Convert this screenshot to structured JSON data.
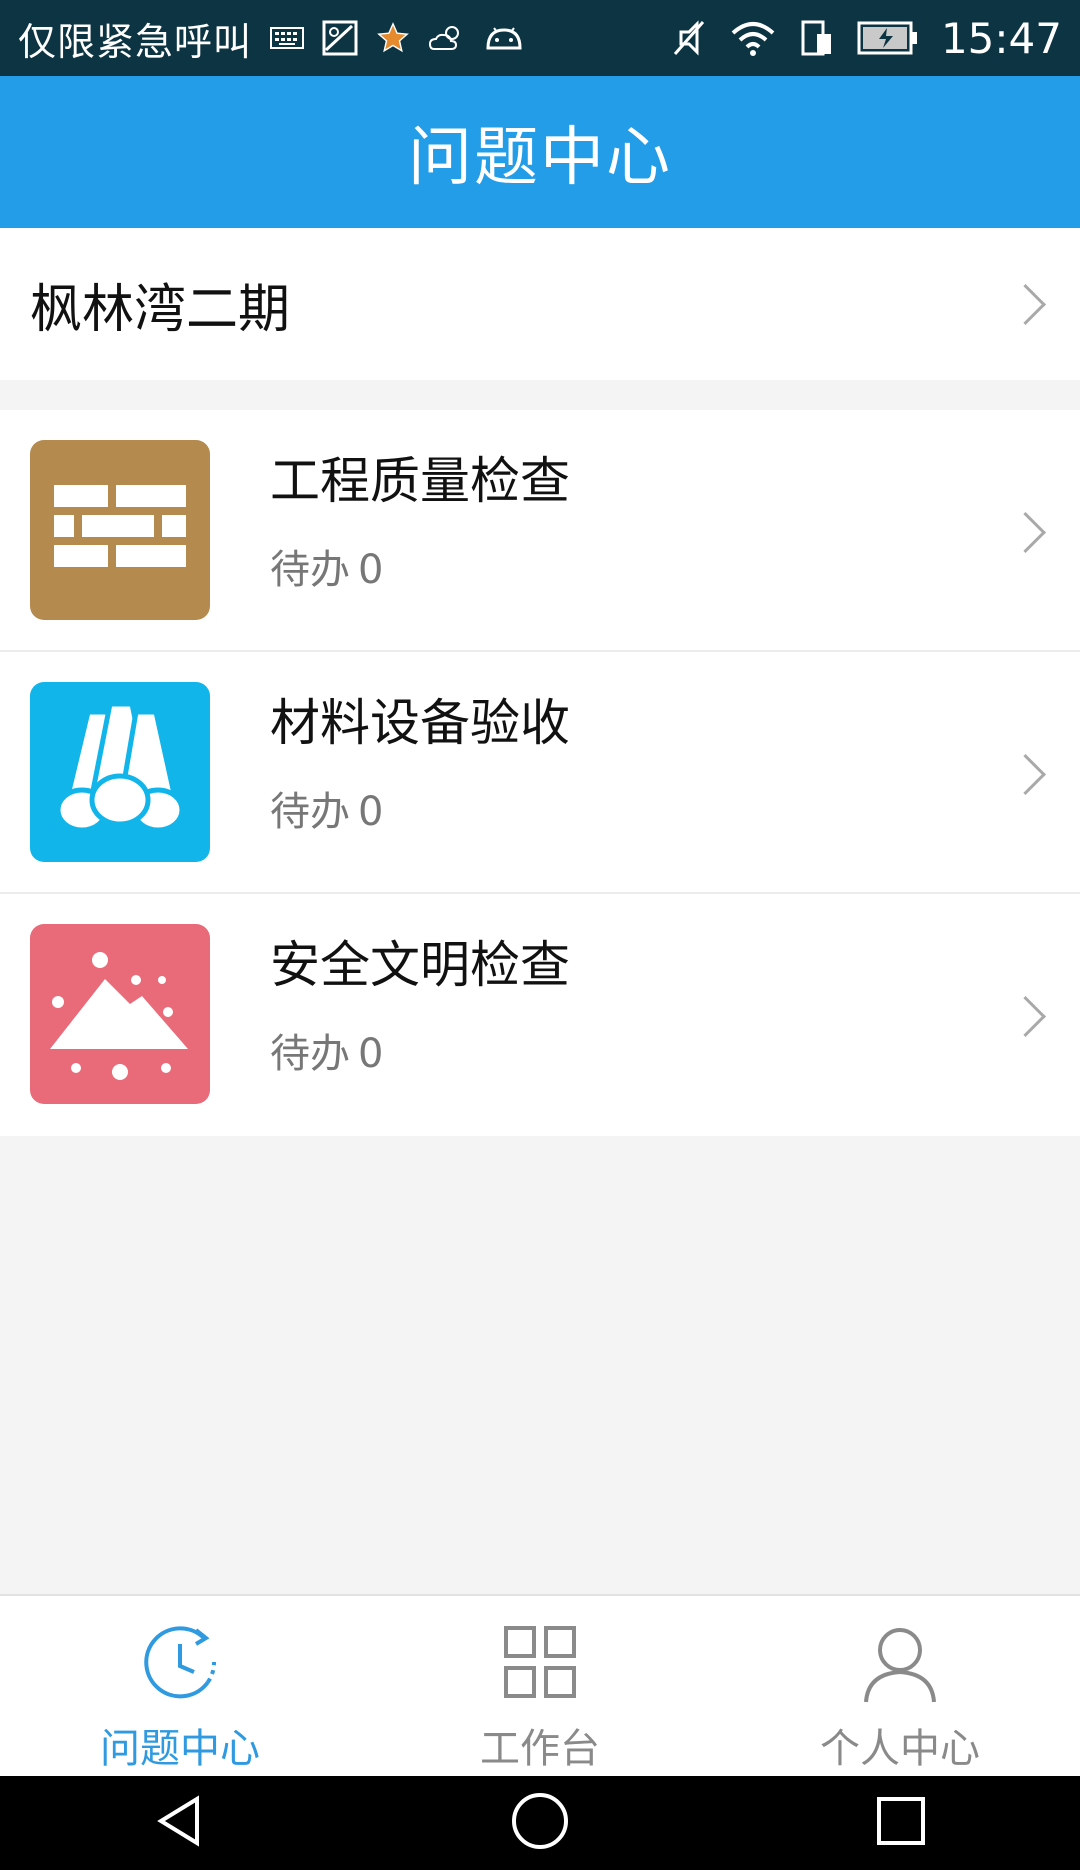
{
  "status_bar": {
    "carrier": "仅限紧急呼叫",
    "time": "15:47",
    "left_icons": [
      "keyboard-icon",
      "image-icon",
      "star-icon",
      "weather-icon",
      "android-icon"
    ],
    "right_icons": [
      "mute-icon",
      "wifi-icon",
      "sim-icon",
      "battery-icon"
    ]
  },
  "header": {
    "title": "问题中心"
  },
  "project": {
    "name": "枫林湾二期"
  },
  "modules": [
    {
      "title": "工程质量检查",
      "pending_label": "待办",
      "pending_count": "0",
      "icon": "brick-wall-icon",
      "color": "#b58a4f"
    },
    {
      "title": "材料设备验收",
      "pending_label": "待办",
      "pending_count": "0",
      "icon": "pipes-icon",
      "color": "#12b5ea"
    },
    {
      "title": "安全文明检查",
      "pending_label": "待办",
      "pending_count": "0",
      "icon": "mountain-icon",
      "color": "#e96a78"
    }
  ],
  "bottom_nav": [
    {
      "label": "问题中心",
      "icon": "clock-icon",
      "active": true
    },
    {
      "label": "工作台",
      "icon": "grid-icon",
      "active": false
    },
    {
      "label": "个人中心",
      "icon": "person-icon",
      "active": false
    }
  ],
  "system_nav": [
    "back-icon",
    "home-icon",
    "recents-icon"
  ],
  "colors": {
    "primary": "#239de8",
    "active_tab": "#2f9ae0",
    "status_bar": "#0d3442"
  }
}
